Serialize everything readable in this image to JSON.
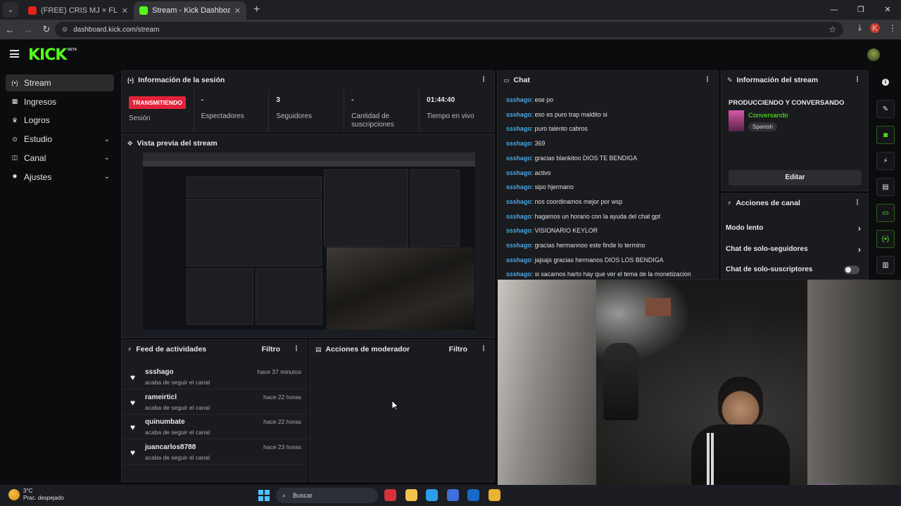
{
  "browser": {
    "tabs": [
      {
        "title": "(FREE) CRIS MJ × FLOYY MENOR",
        "favicon_color": "#e62117"
      },
      {
        "title": "Stream - Kick Dashboard",
        "favicon_color": "#53fc18"
      }
    ],
    "url": "dashboard.kick.com/stream",
    "profile_initial": "K"
  },
  "brand": {
    "logo": "KICK",
    "beta": "BETA",
    "accent": "#53fc18"
  },
  "sidebar": {
    "items": [
      {
        "label": "Stream",
        "icon": "broadcast-icon",
        "glyph": "(•)",
        "active": true,
        "expandable": false
      },
      {
        "label": "Ingresos",
        "icon": "chart-icon",
        "glyph": "▦",
        "active": false,
        "expandable": false
      },
      {
        "label": "Logros",
        "icon": "trophy-icon",
        "glyph": "♛",
        "active": false,
        "expandable": false
      },
      {
        "label": "Estudio",
        "icon": "studio-icon",
        "glyph": "⊙",
        "active": false,
        "expandable": true
      },
      {
        "label": "Canal",
        "icon": "channel-icon",
        "glyph": "◫",
        "active": false,
        "expandable": true
      },
      {
        "label": "Ajustes",
        "icon": "gear-icon",
        "glyph": "✹",
        "active": false,
        "expandable": true
      }
    ]
  },
  "session": {
    "title": "Información de la sesión",
    "live_badge": "TRANSMITIENDO",
    "stats": [
      {
        "value": "",
        "label": "Sesión"
      },
      {
        "value": "-",
        "label": "Espectadores"
      },
      {
        "value": "3",
        "label": "Seguidores"
      },
      {
        "value": "-",
        "label": "Cantidad de suscripciones"
      },
      {
        "value": "01:44:40",
        "label": "Tiempo en vivo"
      }
    ]
  },
  "preview": {
    "title": "Vista previa del stream"
  },
  "feed": {
    "title": "Feed de actividades",
    "filter": "Filtro",
    "items": [
      {
        "user": "ssshago",
        "desc": "acaba de seguir el canal",
        "time": "hace 37 minutos"
      },
      {
        "user": "rameirticl",
        "desc": "acaba de seguir el canal",
        "time": "hace 22 horas"
      },
      {
        "user": "quinumbate",
        "desc": "acaba de seguir el canal",
        "time": "hace 22 horas"
      },
      {
        "user": "juancarlos8788",
        "desc": "acaba de seguir el canal",
        "time": "hace 23 horas"
      }
    ]
  },
  "moderator": {
    "title": "Acciones de moderador",
    "filter": "Filtro"
  },
  "chat": {
    "title": "Chat",
    "username_color": "#4aa8e3",
    "messages": [
      {
        "user": "ssshago",
        "text": ": ese po"
      },
      {
        "user": "ssshago",
        "text": ": eso es puro trap maldito si"
      },
      {
        "user": "ssshago",
        "text": ": puro talento cabros"
      },
      {
        "user": "ssshago",
        "text": ": 369"
      },
      {
        "user": "ssshago",
        "text": ": gracias blankitoo DIOS TE BENDIGA"
      },
      {
        "user": "ssshago",
        "text": ": activo"
      },
      {
        "user": "ssshago",
        "text": ": sipo hjermano"
      },
      {
        "user": "ssshago",
        "text": ": nos coordinamos mejor por wsp"
      },
      {
        "user": "ssshago",
        "text": ": hagamos un horario con la ayuda del chat gpt"
      },
      {
        "user": "ssshago",
        "text": ": VISIONARIO KEYLOR"
      },
      {
        "user": "ssshago",
        "text": ": gracias hermannoo este finde lo termino"
      },
      {
        "user": "ssshago",
        "text": ": jajsajs gracias hermanos DIOS LOS BENDIGA"
      },
      {
        "user": "ssshago",
        "text": ": si sacamos harto hay que ver el tema de la monetizacion"
      }
    ]
  },
  "stream_info": {
    "title": "Información del stream",
    "stream_title": "PRODUCCIENDO Y CONVERSANDO",
    "category": "Conversando",
    "language": "Spanish",
    "edit_label": "Editar"
  },
  "channel_actions": {
    "title": "Acciones de canal",
    "items": [
      {
        "label": "Modo lento",
        "type": "arrow"
      },
      {
        "label": "Chat de solo-seguidores",
        "type": "arrow"
      },
      {
        "label": "Chat de solo-suscriptores",
        "type": "toggle",
        "on": false
      }
    ]
  },
  "rail": {
    "buttons": [
      {
        "icon": "pencil-icon",
        "glyph": "✎",
        "green": false
      },
      {
        "icon": "camera-icon",
        "glyph": "◙",
        "green": true
      },
      {
        "icon": "lightning-icon",
        "glyph": "⚡",
        "green": false
      },
      {
        "icon": "document-icon",
        "glyph": "▤",
        "green": false
      },
      {
        "icon": "chat-bubble-icon",
        "glyph": "▭",
        "green": true
      },
      {
        "icon": "broadcast-icon",
        "glyph": "(•)",
        "green": true
      },
      {
        "icon": "layout-icon",
        "glyph": "▥",
        "green": false
      }
    ]
  },
  "taskbar": {
    "temperature": "3°C",
    "weather": "Prac. despejado",
    "search_placeholder": "Buscar",
    "apps": [
      {
        "name": "app-red-icon",
        "color": "#d6303a"
      },
      {
        "name": "file-explorer-icon",
        "color": "#f2c14e"
      },
      {
        "name": "edge-icon",
        "color": "#2b9ee8"
      },
      {
        "name": "store-icon",
        "color": "#3f6fd8"
      },
      {
        "name": "outlook-icon",
        "color": "#1769c4"
      },
      {
        "name": "chrome-icon",
        "color": "#e8b330"
      }
    ]
  }
}
